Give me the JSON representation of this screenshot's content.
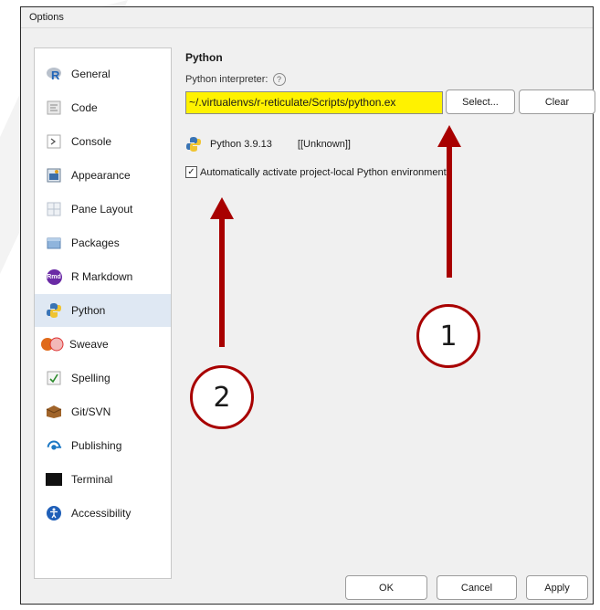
{
  "window": {
    "title": "Options"
  },
  "sidebar": {
    "items": [
      {
        "label": "General",
        "icon": "r-logo-icon"
      },
      {
        "label": "Code",
        "icon": "code-icon"
      },
      {
        "label": "Console",
        "icon": "console-icon"
      },
      {
        "label": "Appearance",
        "icon": "appearance-icon"
      },
      {
        "label": "Pane Layout",
        "icon": "pane-layout-icon"
      },
      {
        "label": "Packages",
        "icon": "packages-icon"
      },
      {
        "label": "R Markdown",
        "icon": "rmd-icon"
      },
      {
        "label": "Python",
        "icon": "python-icon",
        "selected": true
      },
      {
        "label": "Sweave",
        "icon": "sweave-icon"
      },
      {
        "label": "Spelling",
        "icon": "spelling-icon"
      },
      {
        "label": "Git/SVN",
        "icon": "git-icon"
      },
      {
        "label": "Publishing",
        "icon": "publishing-icon"
      },
      {
        "label": "Terminal",
        "icon": "terminal-icon"
      },
      {
        "label": "Accessibility",
        "icon": "accessibility-icon"
      }
    ],
    "rmd_badge": "Rmd"
  },
  "python": {
    "section_title": "Python",
    "interpreter_label": "Python interpreter:",
    "help_glyph": "?",
    "interpreter_path": "~/.virtualenvs/r-reticulate/Scripts/python.ex",
    "select_label": "Select...",
    "clear_label": "Clear",
    "version": "Python 3.9.13",
    "version_status": "[[Unknown]]",
    "auto_activate_label": "Automatically activate project-local Python environments",
    "auto_activate_checked": true
  },
  "footer": {
    "ok_label": "OK",
    "cancel_label": "Cancel",
    "apply_label": "Apply"
  },
  "annotations": {
    "callout_1": "1",
    "callout_2": "2"
  },
  "colors": {
    "highlight": "#fff200",
    "accent": "#a80000",
    "selection": "#dfe8f3"
  }
}
